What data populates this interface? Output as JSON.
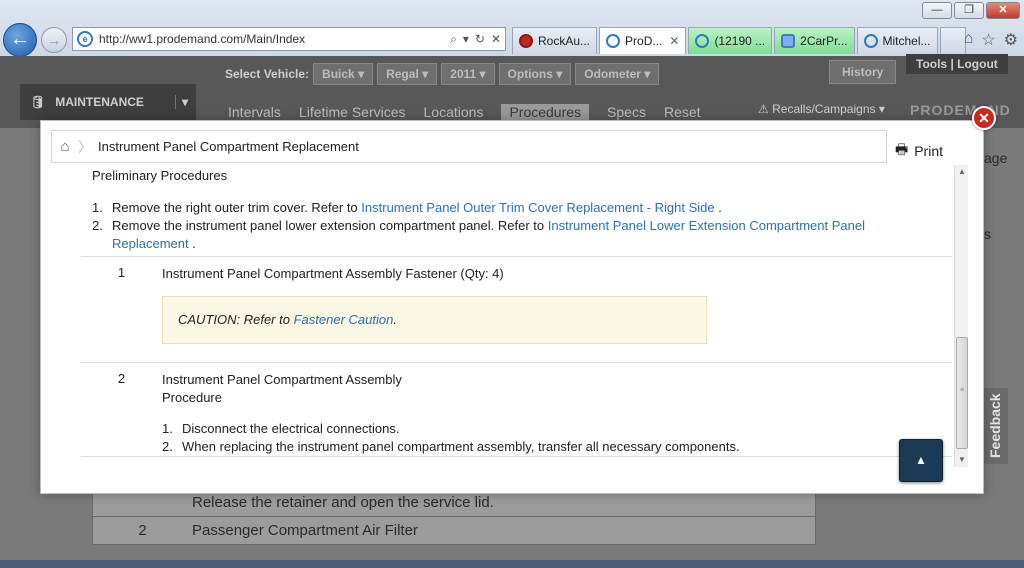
{
  "browser": {
    "url": "http://ww1.prodemand.com/Main/Index",
    "tabs": [
      {
        "label": "RockAu..."
      },
      {
        "label": "ProD..."
      },
      {
        "label": "(12190 ..."
      },
      {
        "label": "2CarPr..."
      },
      {
        "label": "Mitchel..."
      }
    ]
  },
  "app": {
    "select_vehicle_label": "Select Vehicle:",
    "vehicle": [
      "Buick",
      "Regal",
      "2011",
      "Options",
      "Odometer"
    ],
    "history": "History",
    "tools_logout": "Tools | Logout",
    "module": "MAINTENANCE",
    "nav": [
      "Intervals",
      "Lifetime Services",
      "Locations",
      "Procedures",
      "Specs",
      "Reset"
    ],
    "recalls": "Recalls/Campaigns",
    "logo": "PRODEMAND",
    "bg_rows": [
      {
        "num": "",
        "text": "Release the retainer and open the service lid."
      },
      {
        "num": "2",
        "text": "Passenger Compartment Air Filter"
      }
    ],
    "bg_right_frag_1": "age",
    "bg_right_frag_2": "s",
    "feedback": "Feedback"
  },
  "modal": {
    "title": "Instrument Panel Compartment Replacement",
    "print": "Print",
    "section_title": "Preliminary Procedures",
    "prelim": [
      {
        "num": "1.",
        "text": "Remove the right outer trim cover. Refer to ",
        "link": "Instrument Panel Outer Trim Cover Replacement - Right Side",
        "after": " ."
      },
      {
        "num": "2.",
        "text": "Remove the instrument panel lower extension compartment panel. Refer to ",
        "link": "Instrument Panel Lower Extension Compartment Panel Replacement",
        "after": " ."
      }
    ],
    "steps": [
      {
        "num": "1",
        "title": "Instrument Panel Compartment Assembly Fastener (Qty: 4)",
        "caution_text": "CAUTION: Refer to ",
        "caution_link": "Fastener Caution",
        "caution_after": " ."
      },
      {
        "num": "2",
        "title": "Instrument Panel Compartment Assembly",
        "subtitle": "Procedure",
        "substeps": [
          {
            "num": "1.",
            "text": "Disconnect the electrical connections."
          },
          {
            "num": "2.",
            "text": "When replacing the instrument panel compartment assembly, transfer all necessary components."
          }
        ]
      }
    ]
  },
  "colors": {
    "link": "#2f6fb3",
    "caution_bg": "#fbf8e5",
    "close_red": "#c9291d",
    "back_top": "#1a3a55"
  }
}
